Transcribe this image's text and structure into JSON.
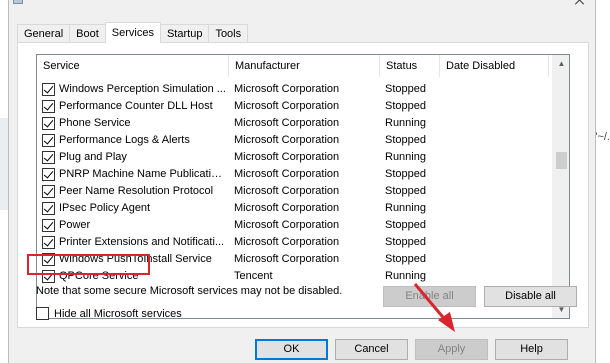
{
  "background": {
    "right_text": "es \"~/."
  },
  "tabs": [
    {
      "label": "General"
    },
    {
      "label": "Boot"
    },
    {
      "label": "Services",
      "active": true
    },
    {
      "label": "Startup"
    },
    {
      "label": "Tools"
    }
  ],
  "columns": [
    "Service",
    "Manufacturer",
    "Status",
    "Date Disabled"
  ],
  "rows": [
    {
      "service": "Windows Perception Simulation ...",
      "manufacturer": "Microsoft Corporation",
      "status": "Stopped",
      "checked": true
    },
    {
      "service": "Performance Counter DLL Host",
      "manufacturer": "Microsoft Corporation",
      "status": "Stopped",
      "checked": true
    },
    {
      "service": "Phone Service",
      "manufacturer": "Microsoft Corporation",
      "status": "Running",
      "checked": true
    },
    {
      "service": "Performance Logs & Alerts",
      "manufacturer": "Microsoft Corporation",
      "status": "Stopped",
      "checked": true
    },
    {
      "service": "Plug and Play",
      "manufacturer": "Microsoft Corporation",
      "status": "Running",
      "checked": true
    },
    {
      "service": "PNRP Machine Name Publication ...",
      "manufacturer": "Microsoft Corporation",
      "status": "Stopped",
      "checked": true
    },
    {
      "service": "Peer Name Resolution Protocol",
      "manufacturer": "Microsoft Corporation",
      "status": "Stopped",
      "checked": true
    },
    {
      "service": "IPsec Policy Agent",
      "manufacturer": "Microsoft Corporation",
      "status": "Running",
      "checked": true
    },
    {
      "service": "Power",
      "manufacturer": "Microsoft Corporation",
      "status": "Stopped",
      "checked": true
    },
    {
      "service": "Printer Extensions and Notificati...",
      "manufacturer": "Microsoft Corporation",
      "status": "Stopped",
      "checked": true
    },
    {
      "service": "Windows PushToInstall Service",
      "manufacturer": "Microsoft Corporation",
      "status": "Stopped",
      "checked": true
    },
    {
      "service": "QPCore Service",
      "manufacturer": "Tencent",
      "status": "Running",
      "checked": true
    }
  ],
  "note": "Note that some secure Microsoft services may not be disabled.",
  "buttons": {
    "enable_all": "Enable all",
    "disable_all": "Disable all",
    "ok": "OK",
    "cancel": "Cancel",
    "apply": "Apply",
    "help": "Help"
  },
  "hide_ms_label": "Hide all Microsoft services",
  "annotation_color": "#d9252e"
}
